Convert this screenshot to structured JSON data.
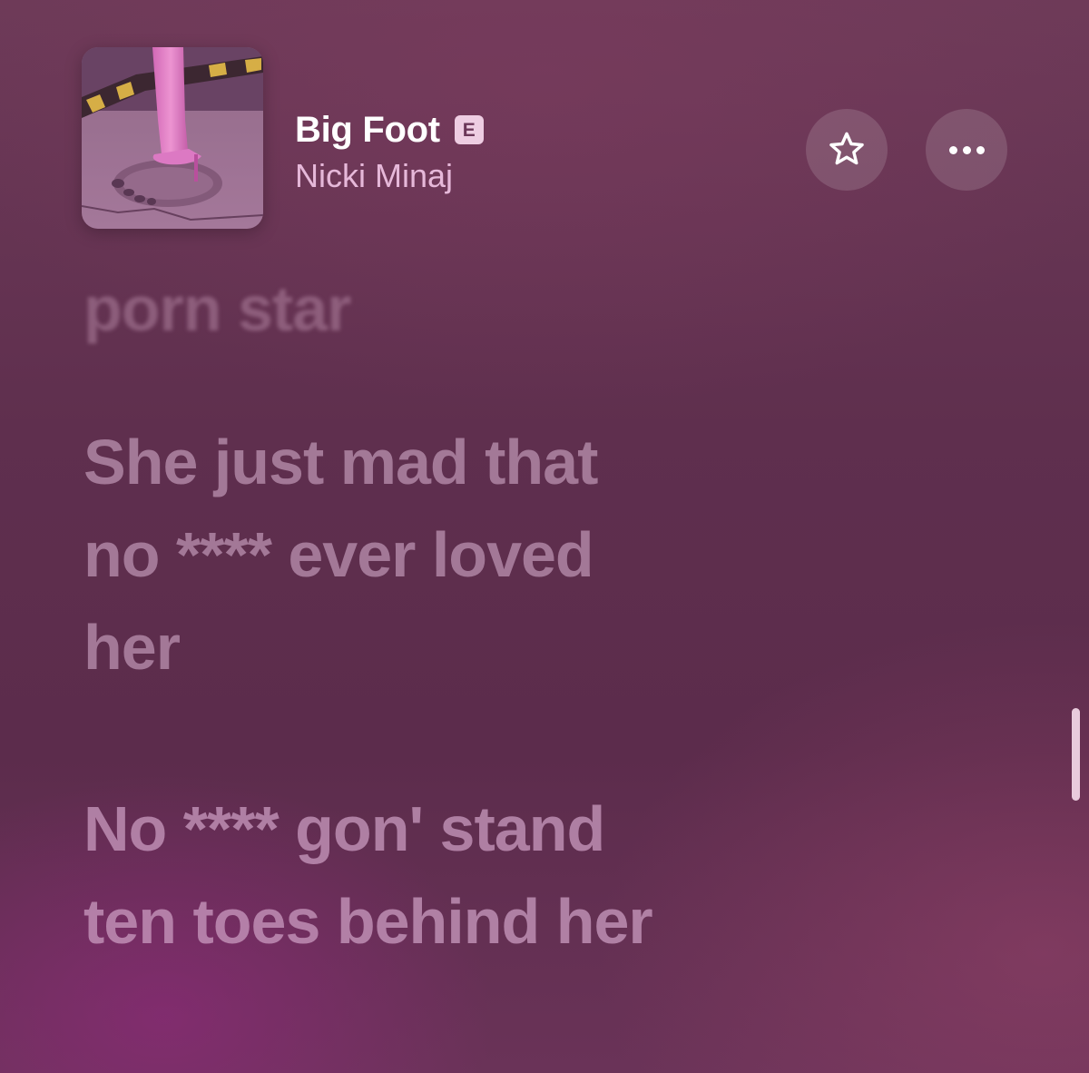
{
  "track": {
    "title": "Big Foot",
    "explicit_badge": "E",
    "artist": "Nicki Minaj"
  },
  "icons": {
    "favorite": "star-outline-icon",
    "more": "ellipsis-icon"
  },
  "lyrics": {
    "previous_line": "porn star",
    "blocks": [
      [
        "She just mad that",
        "no **** ever loved",
        "her"
      ],
      [
        "No **** gon' stand",
        "ten toes behind her"
      ]
    ]
  },
  "colors": {
    "background": "#5f2f4e",
    "accent_pink": "#f0c3e4",
    "explicit_badge_bg": "#ffe1f5"
  }
}
